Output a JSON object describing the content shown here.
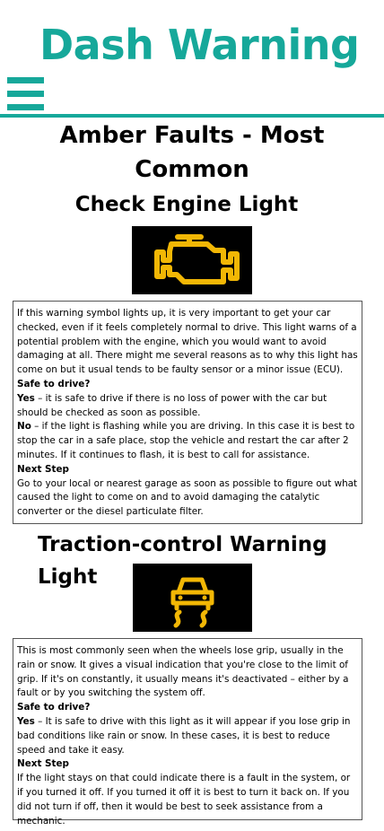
{
  "header": {
    "title": "Dash Warning",
    "menu_icon": "hamburger-menu-icon",
    "accent_color": "#16a89a"
  },
  "section": {
    "heading": "Amber Faults - Most Common"
  },
  "faults": [
    {
      "title": "Check Engine Light",
      "icon": "check-engine-icon",
      "icon_color": "#f2b705",
      "description": "If this warning symbol lights up, it is very important to get your car checked, even if it feels completely normal to drive. This light warns of a potential problem with the engine, which you would want to avoid damaging at all. There might me several reasons as to why this light has come on but it usual tends to be faulty sensor or a minor issue (ECU).",
      "safe_heading": "Safe to drive?",
      "yes_label": "Yes",
      "yes_text": " – it is safe to drive if there is no loss of power with the car but should be checked as soon as possible.",
      "no_label": "No",
      "no_text": " – if the light is flashing while you are driving. In this case it is best to stop the car in a safe place, stop the vehicle and restart the car after 2 minutes. If it continues to flash, it is best to call for assistance.",
      "next_heading": "Next Step",
      "next_text": "Go to your local or nearest garage as soon as possible to figure out what caused the light to come on and to avoid damaging the catalytic converter or the diesel particulate filter."
    },
    {
      "title": "Traction-control Warning Light",
      "icon": "traction-control-icon",
      "icon_color": "#f2b705",
      "description": "This is most commonly seen when the wheels lose grip, usually in the rain or snow. It gives a visual indication that you're close to the limit of grip. If it's on constantly, it usually means it's deactivated – either by a fault or by you switching the system off.",
      "safe_heading": "Safe to drive?",
      "yes_label": "Yes",
      "yes_text": " – It is safe to drive with this light as it will appear if you lose grip in bad conditions like rain or snow. In these cases, it is best to reduce speed and take it easy.",
      "next_heading": "Next Step",
      "next_text": "If the light stays on that could indicate there is a fault in the system, or if you turned it off. If you turned it off it is best to turn it back on. If you did not turn if off, then it would be best to seek assistance from a mechanic."
    }
  ]
}
